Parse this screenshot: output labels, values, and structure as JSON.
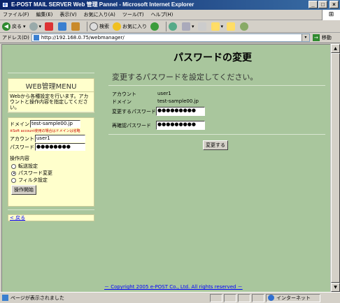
{
  "window": {
    "title": "E-POST MAIL SERVER Web 管理 Pannel - Microsoft Internet Explorer",
    "btn_minimize": "_",
    "btn_maximize": "□",
    "btn_close": "×",
    "logo_glyph": "⊞"
  },
  "menubar": {
    "items": [
      "ファイル(F)",
      "編集(E)",
      "表示(V)",
      "お気に入り(A)",
      "ツール(T)",
      "ヘルプ(H)"
    ]
  },
  "toolbar": {
    "back_label": "戻る",
    "back_arrow": "◀",
    "dropdown_arrow": "▾",
    "search_label": "検索",
    "favorites_label": "お気に入り"
  },
  "address": {
    "label": "アドレス(D)",
    "url": "http://192.168.0.75/webmanager/",
    "go_label": "移動",
    "go_arrow": "→"
  },
  "page": {
    "title": "パスワードの変更",
    "menu": {
      "title": "WEB管理MENU",
      "description": "Webから各種設定を行います。アカウントと操作内容を指定してください。"
    },
    "form": {
      "domain_label": "ドメイン",
      "domain_value": "test-sample00.jp",
      "note": "※Soft account使用の場合はドメインは省略",
      "account_label": "アカウント",
      "account_value": "user1",
      "password_label": "パスワード",
      "password_value": "●●●●●●●●",
      "operation_label": "操作内容",
      "options": [
        "転送設定",
        "パスワード変更",
        "フィルタ設定"
      ],
      "selected_option": "パスワード変更",
      "start_button": "操作開始"
    },
    "back_link": "< 戻る",
    "main": {
      "heading": "変更するパスワードを設定してください。",
      "account_label": "アカウント",
      "account_value": "user1",
      "domain_label": "ドメイン",
      "domain_value": "test-sample00.jp",
      "new_password_label": "変更するパスワード",
      "new_password_value": "●●●●●●●●●",
      "confirm_password_label": "再確認パスワード",
      "confirm_password_value": "●●●●●●●●●",
      "submit_button": "変更する"
    },
    "footer": "－ Copyright 2005 e-POST Co., Ltd. All rights reserved －"
  },
  "statusbar": {
    "message": "ページが表示されました",
    "zone": "インターネット"
  },
  "scrollbar": {
    "up_arrow": "▲",
    "down_arrow": "▼"
  },
  "colors": {
    "page_background": "#a9c69d",
    "panel_background": "#ffffcc",
    "titlebar": "#0a246a",
    "link": "#0000ff"
  }
}
